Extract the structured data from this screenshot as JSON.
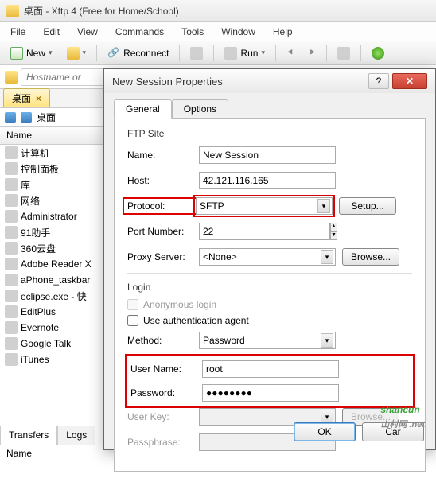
{
  "titlebar": {
    "text": "桌面 - Xftp 4 (Free for Home/School)"
  },
  "menu": {
    "file": "File",
    "edit": "Edit",
    "view": "View",
    "commands": "Commands",
    "tools": "Tools",
    "window": "Window",
    "help": "Help"
  },
  "toolbar": {
    "new": "New",
    "reconnect": "Reconnect",
    "run": "Run"
  },
  "addressbar": {
    "placeholder": "Hostname or"
  },
  "left": {
    "tab": "桌面",
    "crumb": "桌面",
    "name_header": "Name",
    "items": [
      {
        "label": "计算机"
      },
      {
        "label": "控制面板"
      },
      {
        "label": "库"
      },
      {
        "label": "网络"
      },
      {
        "label": "Administrator"
      },
      {
        "label": "91助手"
      },
      {
        "label": "360云盘"
      },
      {
        "label": "Adobe Reader X"
      },
      {
        "label": "aPhone_taskbar"
      },
      {
        "label": "eclipse.exe - 快"
      },
      {
        "label": "EditPlus"
      },
      {
        "label": "Evernote"
      },
      {
        "label": "Google Talk"
      },
      {
        "label": "iTunes"
      }
    ],
    "transfers_tab": "Transfers",
    "logs_tab": "Logs",
    "bottom_name": "Name"
  },
  "dialog": {
    "title": "New Session Properties",
    "tab_general": "General",
    "tab_options": "Options",
    "ftp_site": "FTP Site",
    "name_label": "Name:",
    "name_value": "New Session",
    "host_label": "Host:",
    "host_value": "42.121.116.165",
    "protocol_label": "Protocol:",
    "protocol_value": "SFTP",
    "setup_btn": "Setup...",
    "port_label": "Port Number:",
    "port_value": "22",
    "proxy_label": "Proxy Server:",
    "proxy_value": "<None>",
    "browse_btn": "Browse...",
    "login": "Login",
    "anon": "Anonymous login",
    "auth_agent": "Use authentication agent",
    "method_label": "Method:",
    "method_value": "Password",
    "user_label": "User Name:",
    "user_value": "root",
    "pass_label": "Password:",
    "pass_value": "●●●●●●●●",
    "userkey_label": "User Key:",
    "passphrase_label": "Passphrase:",
    "ok": "OK",
    "cancel": "Car"
  },
  "watermark": {
    "brand": "shancun",
    "sub": "山村网 .net"
  }
}
